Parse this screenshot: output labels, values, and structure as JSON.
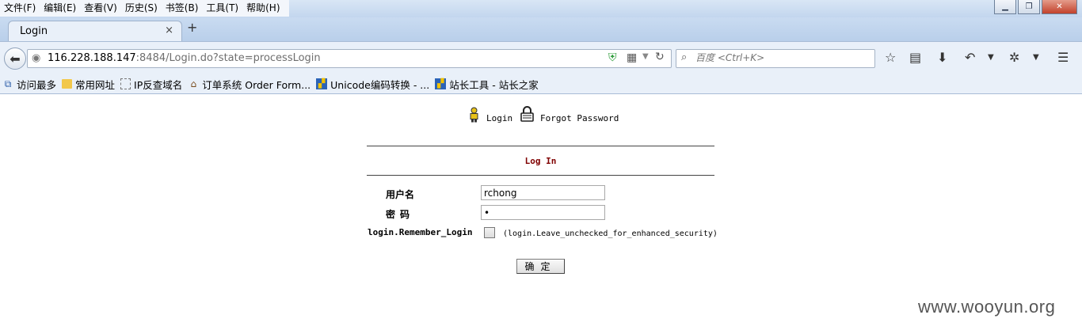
{
  "menu": [
    "文件(F)",
    "编辑(E)",
    "查看(V)",
    "历史(S)",
    "书签(B)",
    "工具(T)",
    "帮助(H)"
  ],
  "window_controls": [
    "minimize-icon",
    "maximize-icon",
    "close-icon"
  ],
  "tab": {
    "title": "Login",
    "close": "×",
    "new_tab": "+"
  },
  "address": {
    "host": "116.228.188.147",
    "path": ":8484/Login.do?state=processLogin"
  },
  "search": {
    "placeholder": "百度 <Ctrl+K>"
  },
  "bookmarks": [
    {
      "label": "访问最多",
      "icon": "bookmark-icon"
    },
    {
      "label": "常用网址",
      "icon": "folder-icon"
    },
    {
      "label": "IP反查域名",
      "icon": "page-icon"
    },
    {
      "label": "订单系统 Order Form...",
      "icon": "home-icon"
    },
    {
      "label": "Unicode编码转换 - ...",
      "icon": "site-icon"
    },
    {
      "label": "站长工具 - 站长之家",
      "icon": "site-icon"
    }
  ],
  "page": {
    "nav_login": "Login",
    "nav_forgot": "Forgot Password",
    "heading": "Log In",
    "username_label": "用户名",
    "username_value": "rchong",
    "password_label": "密码",
    "password_value": "•",
    "remember_label": "login.Remember_Login",
    "remember_hint": "(login.Leave_unchecked_for_enhanced_security)",
    "submit_label": "确定",
    "heading_color": "#800000"
  },
  "watermark": "www.wooyun.org"
}
